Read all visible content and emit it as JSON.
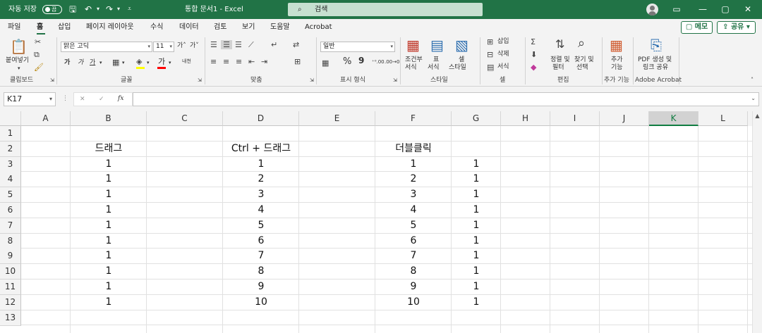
{
  "titlebar": {
    "autosave_label": "자동 저장",
    "autosave_state": "끔",
    "title": "통합 문서1  -  Excel",
    "search_placeholder": "검색",
    "ribbon_display_icon": "ribbon-display-icon",
    "minimize_icon": "minimize-icon",
    "maximize_icon": "maximize-icon",
    "close_icon": "close-icon",
    "accent": "#217346"
  },
  "tabs": [
    "파일",
    "홈",
    "삽입",
    "페이지 레이아웃",
    "수식",
    "데이터",
    "검토",
    "보기",
    "도움말",
    "Acrobat"
  ],
  "active_tab": "홈",
  "memo_label": "메모",
  "share_label": "공유",
  "ribbon": {
    "clipboard": {
      "paste": "붙여넣기",
      "group": "클립보드"
    },
    "font": {
      "name": "맑은 고딕",
      "size": "11",
      "bold": "가",
      "italic": "가",
      "underline": "가",
      "color_glyph": "가",
      "group": "글꼴"
    },
    "align": {
      "group": "맞춤"
    },
    "number": {
      "format": "일반",
      "percent": "%",
      "comma": "9",
      "group": "표시 형식"
    },
    "styles": {
      "cond": [
        "조건부",
        "서식"
      ],
      "table": [
        "표",
        "서식"
      ],
      "cell": [
        "셀",
        "스타일"
      ],
      "group": "스타일"
    },
    "cells": {
      "insert": "삽입",
      "delete": "삭제",
      "format": "서식",
      "group": "셀"
    },
    "editing": {
      "sort": [
        "정렬 및",
        "필터"
      ],
      "find": [
        "찾기 및",
        "선택"
      ],
      "group": "편집"
    },
    "addins": {
      "label": [
        "추가",
        "기능"
      ],
      "group": "추가 기능"
    },
    "acrobat": {
      "label": [
        "PDF 생성 및",
        "링크 공유"
      ],
      "group": "Adobe Acrobat"
    }
  },
  "namebox": "K17",
  "fx_label": "fx",
  "columns": [
    "A",
    "B",
    "C",
    "D",
    "E",
    "F",
    "G",
    "H",
    "I",
    "J",
    "K",
    "L"
  ],
  "selected_column": "K",
  "rows": [
    "1",
    "2",
    "3",
    "4",
    "5",
    "6",
    "7",
    "8",
    "9",
    "10",
    "11",
    "12",
    "13"
  ],
  "headers": {
    "B": "드래그",
    "D": "Ctrl + 드래그",
    "F": "더블클릭"
  },
  "col_B": [
    "1",
    "1",
    "1",
    "1",
    "1",
    "1",
    "1",
    "1",
    "1",
    "1"
  ],
  "col_D": [
    "1",
    "2",
    "3",
    "4",
    "5",
    "6",
    "7",
    "8",
    "9",
    "10"
  ],
  "col_F": [
    "1",
    "2",
    "3",
    "4",
    "5",
    "6",
    "7",
    "8",
    "9",
    "10"
  ],
  "col_G": [
    "1",
    "1",
    "1",
    "1",
    "1",
    "1",
    "1",
    "1",
    "1",
    "1"
  ]
}
